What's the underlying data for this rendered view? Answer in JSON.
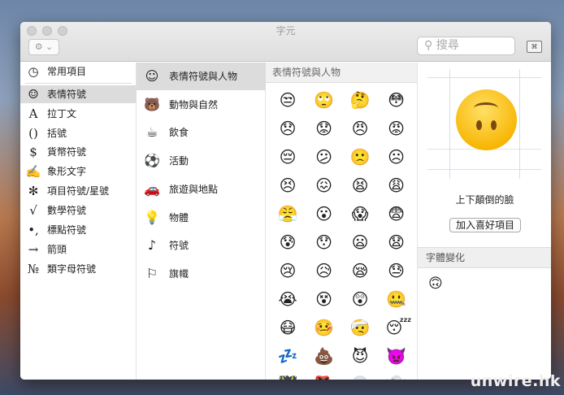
{
  "window": {
    "title": "字元",
    "gear_label": "⚙ ⌄",
    "search_placeholder": "搜尋",
    "keyboard_icon": "⌘"
  },
  "sidebar": [
    {
      "icon": "◷",
      "label": "常用項目"
    },
    {
      "icon": "☺",
      "label": "表情符號"
    },
    {
      "icon": "A",
      "label": "拉丁文"
    },
    {
      "icon": "()",
      "label": "括號"
    },
    {
      "icon": "$",
      "label": "貨幣符號"
    },
    {
      "icon": "✍",
      "label": "象形文字"
    },
    {
      "icon": "✻",
      "label": "項目符號/星號"
    },
    {
      "icon": "√",
      "label": "數學符號"
    },
    {
      "icon": "•,",
      "label": "標點符號"
    },
    {
      "icon": "→",
      "label": "箭頭"
    },
    {
      "icon": "№",
      "label": "類字母符號"
    }
  ],
  "categories": [
    {
      "icon": "☺",
      "label": "表情符號與人物"
    },
    {
      "icon": "🐻",
      "label": "動物與自然"
    },
    {
      "icon": "☕",
      "label": "飲食"
    },
    {
      "icon": "⚽",
      "label": "活動"
    },
    {
      "icon": "🚗",
      "label": "旅遊與地點"
    },
    {
      "icon": "💡",
      "label": "物體"
    },
    {
      "icon": "♪",
      "label": "符號"
    },
    {
      "icon": "⚐",
      "label": "旗幟"
    }
  ],
  "grid": {
    "header": "表情符號與人物",
    "emojis": [
      "😒",
      "🙄",
      "🤔",
      "😳",
      "😞",
      "😟",
      "😠",
      "😡",
      "😔",
      "😕",
      "🙁",
      "☹",
      "😣",
      "😖",
      "😫",
      "😩",
      "😤",
      "😮",
      "😱",
      "😨",
      "😰",
      "😯",
      "😦",
      "😧",
      "😢",
      "😥",
      "😪",
      "😓",
      "😭",
      "😵",
      "😲",
      "🤐",
      "😷",
      "🤒",
      "🤕",
      "😴",
      "💤",
      "💩",
      "😈",
      "👿",
      "👹",
      "👺",
      "💀",
      "👻"
    ]
  },
  "detail": {
    "name": "上下顛倒的臉",
    "add_favorite": "加入喜好項目",
    "variations_header": "字體變化",
    "variation": "🙃"
  },
  "watermark": "unwire.hk"
}
